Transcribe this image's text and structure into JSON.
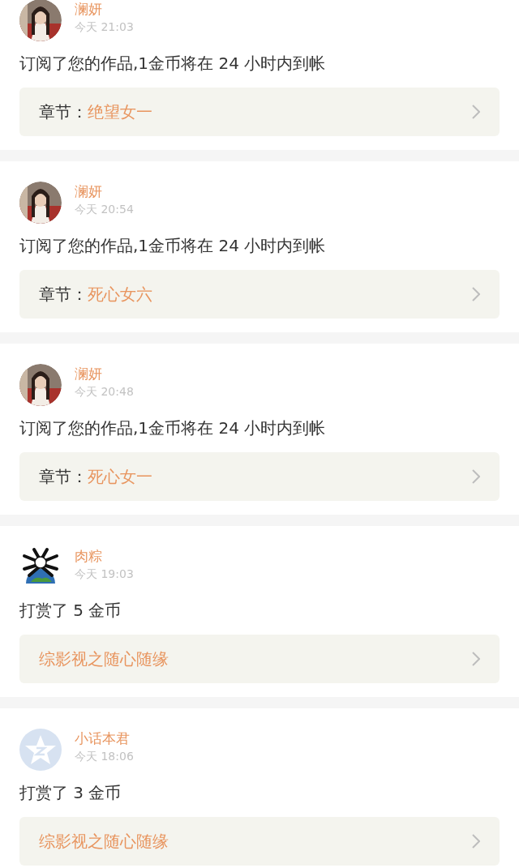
{
  "entries": [
    {
      "name": "澜妍",
      "time": "今天 21:03",
      "message": "订阅了您的作品,1金币将在 24 小时内到帐",
      "card": {
        "kind": "chapter",
        "label": "章节：",
        "title": "绝望女一"
      }
    },
    {
      "name": "澜妍",
      "time": "今天 20:54",
      "message": "订阅了您的作品,1金币将在 24 小时内到帐",
      "card": {
        "kind": "chapter",
        "label": "章节：",
        "title": "死心女六"
      }
    },
    {
      "name": "澜妍",
      "time": "今天 20:48",
      "message": "订阅了您的作品,1金币将在 24 小时内到帐",
      "card": {
        "kind": "chapter",
        "label": "章节：",
        "title": "死心女一"
      }
    },
    {
      "avatar": {
        "kind": "cartoon"
      },
      "name": "肉粽",
      "time": "今天 19:03",
      "message": "打赏了 5 金币",
      "card": {
        "kind": "work",
        "title": "综影视之随心随缘"
      }
    },
    {
      "avatar": {
        "kind": "default"
      },
      "name": "小话本君",
      "time": "今天 18:06",
      "message": "打赏了 3 金币",
      "card": {
        "kind": "work",
        "title": "综影视之随心随缘"
      }
    }
  ]
}
